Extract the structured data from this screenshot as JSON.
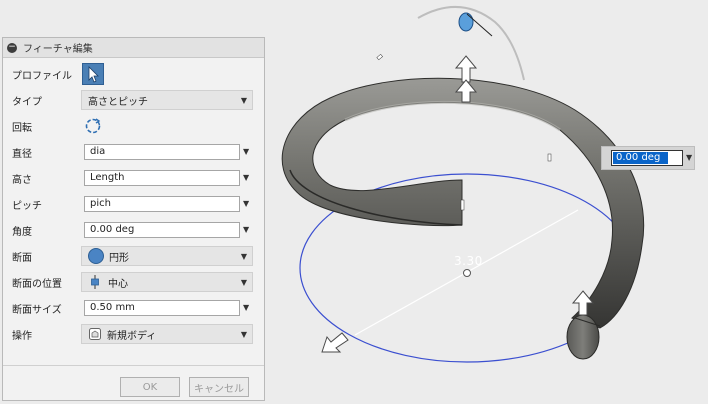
{
  "panel": {
    "title": "フィーチャ編集",
    "profile": {
      "label": "プロファイル"
    },
    "type": {
      "label": "タイプ",
      "value": "高さとピッチ"
    },
    "rotation": {
      "label": "回転"
    },
    "diameter": {
      "label": "直径",
      "value": "dia"
    },
    "height": {
      "label": "高さ",
      "value": "Length"
    },
    "pitch": {
      "label": "ピッチ",
      "value": "pich"
    },
    "angle": {
      "label": "角度",
      "value": "0.00 deg"
    },
    "section": {
      "label": "断面",
      "value": "円形"
    },
    "section_position": {
      "label": "断面の位置",
      "value": "中心"
    },
    "section_size": {
      "label": "断面サイズ",
      "value": "0.50 mm"
    },
    "operation": {
      "label": "操作",
      "value": "新規ボディ"
    },
    "ok_label": "OK",
    "cancel_label": "キャンセル"
  },
  "viewport": {
    "angle_input": "0.00 deg",
    "dimension_label": "3.30"
  },
  "colors": {
    "accent": "#0a64c8",
    "sketch_circle": "#3b4fd0",
    "coil": "#6f6f6b",
    "manipulator": "#5a9fdb"
  }
}
